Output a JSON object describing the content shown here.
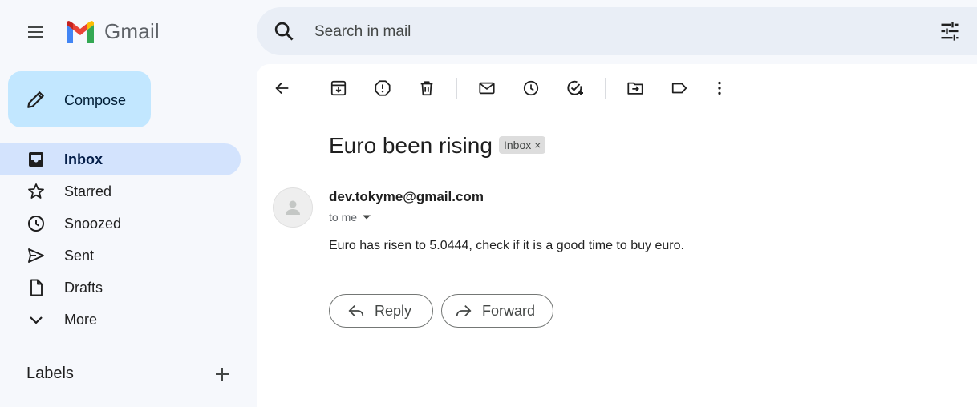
{
  "app": {
    "name": "Gmail"
  },
  "search": {
    "placeholder": "Search in mail"
  },
  "sidebar": {
    "compose_label": "Compose",
    "items": [
      {
        "label": "Inbox",
        "icon": "inbox-icon",
        "active": true
      },
      {
        "label": "Starred",
        "icon": "star-icon",
        "active": false
      },
      {
        "label": "Snoozed",
        "icon": "clock-icon",
        "active": false
      },
      {
        "label": "Sent",
        "icon": "send-icon",
        "active": false
      },
      {
        "label": "Drafts",
        "icon": "draft-icon",
        "active": false
      },
      {
        "label": "More",
        "icon": "chevron-down-icon",
        "active": false
      }
    ],
    "labels_title": "Labels"
  },
  "email": {
    "subject": "Euro been rising",
    "chip_label": "Inbox",
    "chip_close": "×",
    "sender": "dev.tokyme@gmail.com",
    "recipient": "to me",
    "body": "Euro has risen to 5.0444, check if it is a good time to buy euro."
  },
  "actions": {
    "reply_label": "Reply",
    "forward_label": "Forward"
  },
  "colors": {
    "background": "#f6f8fc",
    "search_bg": "#e9eef6",
    "compose_bg": "#c2e7ff",
    "active_nav_bg": "#d3e3fd",
    "gmail_red": "#ea4335",
    "gmail_blue": "#4285f4",
    "gmail_green": "#34a853",
    "gmail_yellow": "#fbbc04"
  }
}
